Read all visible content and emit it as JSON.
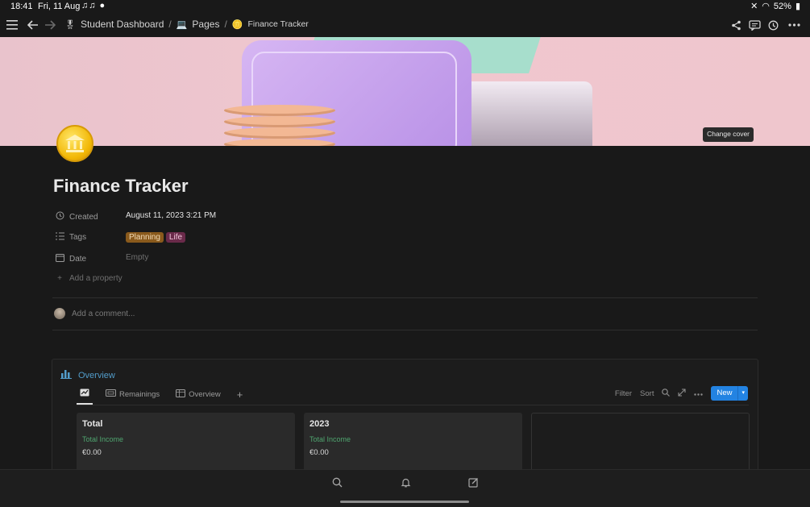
{
  "status_bar": {
    "time": "18:41",
    "date": "Fri, 11 Aug",
    "battery": "52%"
  },
  "breadcrumbs": {
    "root": "Student Dashboard",
    "root_emoji": "🎖",
    "mid": "Pages",
    "mid_emoji": "💻",
    "current": "Finance Tracker",
    "current_emoji": "🪙"
  },
  "cover": {
    "change_label": "Change cover"
  },
  "page": {
    "title": "Finance Tracker",
    "icon": "bank-coin-icon"
  },
  "properties": [
    {
      "name": "Created",
      "value": "August 11, 2023 3:21 PM",
      "icon": "clock-icon"
    },
    {
      "name": "Tags",
      "icon": "list-icon",
      "tags": [
        "Planning",
        "Life"
      ]
    },
    {
      "name": "Date",
      "value": "Empty",
      "icon": "calendar-icon"
    }
  ],
  "add_property": "Add a property",
  "comment_placeholder": "Add a comment...",
  "database": {
    "title": "Overview",
    "views": [
      {
        "label": "",
        "icon": "chart-icon"
      },
      {
        "label": "Remainings",
        "icon": "gallery-icon"
      },
      {
        "label": "Overview",
        "icon": "table-icon"
      }
    ],
    "filter": "Filter",
    "sort": "Sort",
    "new_label": "New",
    "cards": [
      {
        "title": "Total",
        "field": "Total Income",
        "value": "€0.00"
      },
      {
        "title": "2023",
        "field": "Total Income",
        "value": "€0.00"
      }
    ]
  },
  "colors": {
    "accent": "#2383e2",
    "link": "#529cca",
    "income": "#4fa56f"
  }
}
